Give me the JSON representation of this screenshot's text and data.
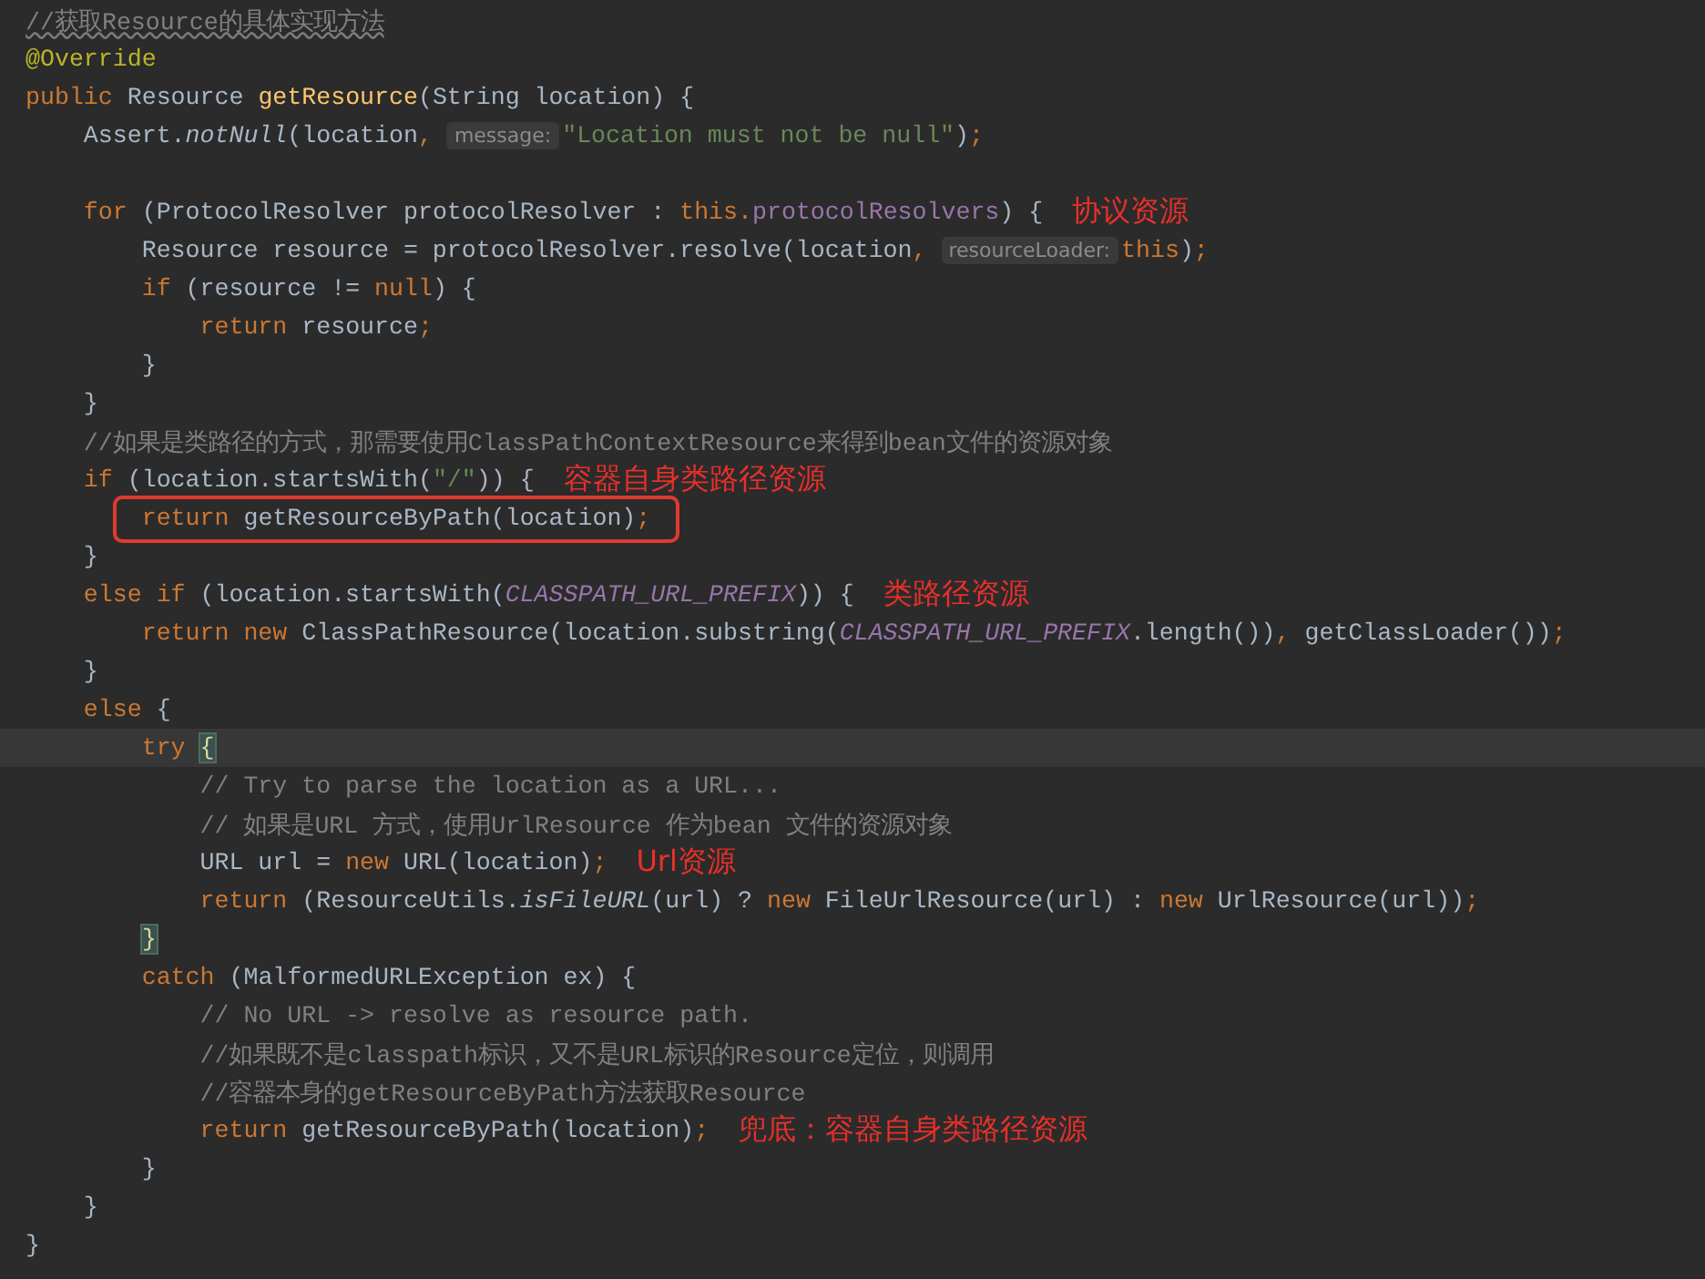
{
  "lines": [
    {
      "current": false,
      "boxed": false,
      "tokens": [
        {
          "kind": "spellcheck",
          "text": "//获取Resource的具体实现方法"
        }
      ]
    },
    {
      "current": false,
      "boxed": false,
      "tokens": [
        {
          "kind": "annotation",
          "text": "@Override"
        }
      ]
    },
    {
      "current": false,
      "boxed": false,
      "tokens": [
        {
          "kind": "keyword",
          "text": "public"
        },
        {
          "kind": "plain",
          "text": " Resource "
        },
        {
          "kind": "method",
          "text": "getResource"
        },
        {
          "kind": "plain",
          "text": "(String location) {"
        }
      ]
    },
    {
      "current": false,
      "boxed": false,
      "tokens": [
        {
          "kind": "plain",
          "text": "    Assert."
        },
        {
          "kind": "static",
          "text": "notNull"
        },
        {
          "kind": "plain",
          "text": "(location"
        },
        {
          "kind": "keyword",
          "text": ", "
        },
        {
          "kind": "hint",
          "text": "message:"
        },
        {
          "kind": "string",
          "text": "\"Location must not be null\""
        },
        {
          "kind": "plain",
          "text": ")"
        },
        {
          "kind": "keyword",
          "text": ";"
        }
      ]
    },
    {
      "current": false,
      "boxed": false
    },
    {
      "current": false,
      "boxed": false,
      "tokens": [
        {
          "kind": "keyword",
          "text": "    for"
        },
        {
          "kind": "plain",
          "text": " (ProtocolResolver protocolResolver : "
        },
        {
          "kind": "keyword",
          "text": "this."
        },
        {
          "kind": "field",
          "text": "protocolResolvers"
        },
        {
          "kind": "plain",
          "text": ") {"
        },
        {
          "kind": "note",
          "text": "协议资源"
        }
      ]
    },
    {
      "current": false,
      "boxed": false,
      "tokens": [
        {
          "kind": "plain",
          "text": "        Resource resource = protocolResolver.resolve(location"
        },
        {
          "kind": "keyword",
          "text": ", "
        },
        {
          "kind": "hint",
          "text": "resourceLoader:"
        },
        {
          "kind": "keyword",
          "text": "this"
        },
        {
          "kind": "plain",
          "text": ")"
        },
        {
          "kind": "keyword",
          "text": ";"
        }
      ]
    },
    {
      "current": false,
      "boxed": false,
      "tokens": [
        {
          "kind": "keyword",
          "text": "        if"
        },
        {
          "kind": "plain",
          "text": " (resource != "
        },
        {
          "kind": "keyword",
          "text": "null"
        },
        {
          "kind": "plain",
          "text": ") {"
        }
      ]
    },
    {
      "current": false,
      "boxed": false,
      "tokens": [
        {
          "kind": "keyword",
          "text": "            return"
        },
        {
          "kind": "plain",
          "text": " resource"
        },
        {
          "kind": "keyword",
          "text": ";"
        }
      ]
    },
    {
      "current": false,
      "boxed": false,
      "tokens": [
        {
          "kind": "plain",
          "text": "        }"
        }
      ]
    },
    {
      "current": false,
      "boxed": false,
      "tokens": [
        {
          "kind": "plain",
          "text": "    }"
        }
      ]
    },
    {
      "current": false,
      "boxed": false,
      "tokens": [
        {
          "kind": "comment",
          "text": "    //如果是类路径的方式，那需要使用ClassPathContextResource来得到bean文件的资源对象"
        }
      ]
    },
    {
      "current": false,
      "boxed": false,
      "tokens": [
        {
          "kind": "keyword",
          "text": "    if"
        },
        {
          "kind": "plain",
          "text": " (location.startsWith("
        },
        {
          "kind": "string",
          "text": "\"/\""
        },
        {
          "kind": "plain",
          "text": ")) {"
        },
        {
          "kind": "note",
          "text": "容器自身类路径资源"
        }
      ]
    },
    {
      "current": false,
      "boxed": true,
      "tokens": [
        {
          "kind": "keyword",
          "text": "        return"
        },
        {
          "kind": "plain",
          "text": " getResourceByPath(location)"
        },
        {
          "kind": "keyword",
          "text": ";"
        }
      ]
    },
    {
      "current": false,
      "boxed": false,
      "tokens": [
        {
          "kind": "plain",
          "text": "    }"
        }
      ]
    },
    {
      "current": false,
      "boxed": false,
      "tokens": [
        {
          "kind": "keyword",
          "text": "    else if"
        },
        {
          "kind": "plain",
          "text": " (location.startsWith("
        },
        {
          "kind": "constant",
          "text": "CLASSPATH_URL_PREFIX"
        },
        {
          "kind": "plain",
          "text": ")) {"
        },
        {
          "kind": "note",
          "text": "类路径资源"
        }
      ]
    },
    {
      "current": false,
      "boxed": false,
      "tokens": [
        {
          "kind": "keyword",
          "text": "        return new"
        },
        {
          "kind": "plain",
          "text": " ClassPathResource(location.substring("
        },
        {
          "kind": "constant",
          "text": "CLASSPATH_URL_PREFIX"
        },
        {
          "kind": "plain",
          "text": ".length())"
        },
        {
          "kind": "keyword",
          "text": ", "
        },
        {
          "kind": "plain",
          "text": "getClassLoader())"
        },
        {
          "kind": "keyword",
          "text": ";"
        }
      ]
    },
    {
      "current": false,
      "boxed": false,
      "tokens": [
        {
          "kind": "plain",
          "text": "    }"
        }
      ]
    },
    {
      "current": false,
      "boxed": false,
      "tokens": [
        {
          "kind": "keyword",
          "text": "    else"
        },
        {
          "kind": "plain",
          "text": " {"
        }
      ]
    },
    {
      "current": true,
      "boxed": false,
      "tokens": [
        {
          "kind": "keyword",
          "text": "        try "
        },
        {
          "kind": "brace",
          "text": "{"
        }
      ]
    },
    {
      "current": false,
      "boxed": false,
      "tokens": [
        {
          "kind": "comment",
          "text": "            // Try to parse the location as a URL..."
        }
      ]
    },
    {
      "current": false,
      "boxed": false,
      "tokens": [
        {
          "kind": "comment",
          "text": "            // 如果是URL 方式，使用UrlResource 作为bean 文件的资源对象"
        }
      ]
    },
    {
      "current": false,
      "boxed": false,
      "tokens": [
        {
          "kind": "plain",
          "text": "            URL url = "
        },
        {
          "kind": "keyword",
          "text": "new"
        },
        {
          "kind": "plain",
          "text": " URL(location)"
        },
        {
          "kind": "keyword",
          "text": ";"
        },
        {
          "kind": "note",
          "text": "Url资源"
        }
      ]
    },
    {
      "current": false,
      "boxed": false,
      "tokens": [
        {
          "kind": "keyword",
          "text": "            return"
        },
        {
          "kind": "plain",
          "text": " (ResourceUtils."
        },
        {
          "kind": "static",
          "text": "isFileURL"
        },
        {
          "kind": "plain",
          "text": "(url) ? "
        },
        {
          "kind": "keyword",
          "text": "new"
        },
        {
          "kind": "plain",
          "text": " FileUrlResource(url) : "
        },
        {
          "kind": "keyword",
          "text": "new"
        },
        {
          "kind": "plain",
          "text": " UrlResource(url))"
        },
        {
          "kind": "keyword",
          "text": ";"
        }
      ]
    },
    {
      "current": false,
      "boxed": false,
      "tokens": [
        {
          "kind": "brace",
          "text": "        }"
        }
      ]
    },
    {
      "current": false,
      "boxed": false,
      "tokens": [
        {
          "kind": "keyword",
          "text": "        catch"
        },
        {
          "kind": "plain",
          "text": " (MalformedURLException ex) {"
        }
      ]
    },
    {
      "current": false,
      "boxed": false,
      "tokens": [
        {
          "kind": "comment",
          "text": "            // No URL -> resolve as resource path."
        }
      ]
    },
    {
      "current": false,
      "boxed": false,
      "tokens": [
        {
          "kind": "comment",
          "text": "            //如果既不是classpath标识，又不是URL标识的Resource定位，则调用"
        }
      ]
    },
    {
      "current": false,
      "boxed": false,
      "tokens": [
        {
          "kind": "comment",
          "text": "            //容器本身的getResourceByPath方法获取Resource"
        }
      ]
    },
    {
      "current": false,
      "boxed": false,
      "tokens": [
        {
          "kind": "keyword",
          "text": "            return"
        },
        {
          "kind": "plain",
          "text": " getResourceByPath(location)"
        },
        {
          "kind": "keyword",
          "text": ";"
        },
        {
          "kind": "note",
          "text": "兜底：容器自身类路径资源"
        }
      ]
    },
    {
      "current": false,
      "boxed": false,
      "tokens": [
        {
          "kind": "plain",
          "text": "        }"
        }
      ]
    },
    {
      "current": false,
      "boxed": false,
      "tokens": [
        {
          "kind": "plain",
          "text": "    }"
        }
      ]
    },
    {
      "current": false,
      "boxed": false,
      "tokens": [
        {
          "kind": "plain",
          "text": "}"
        }
      ]
    }
  ]
}
